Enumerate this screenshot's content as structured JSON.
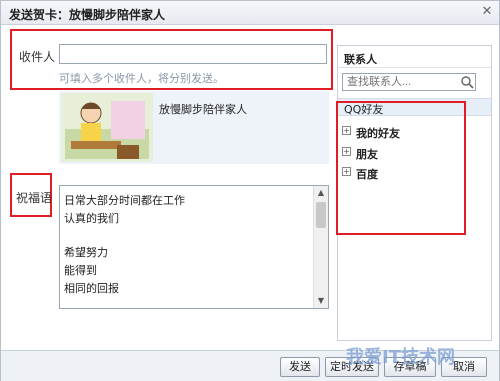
{
  "window": {
    "title": "发送贺卡：放慢脚步陪伴家人",
    "close_glyph": "✕"
  },
  "recipients": {
    "label": "收件人",
    "value": "",
    "hint": "可填入多个收件人，将分别发送。"
  },
  "card": {
    "name": "放慢脚步陪伴家人"
  },
  "blessing": {
    "label": "祝福语",
    "lines": [
      "日常大部分时间都在工作",
      "认真的我们",
      "",
      "希望努力",
      "能得到",
      "相同的回报"
    ]
  },
  "contacts": {
    "title": "联系人",
    "search_placeholder": "查找联系人...",
    "group": "QQ好友",
    "items": [
      {
        "label": "我的好友"
      },
      {
        "label": "朋友"
      },
      {
        "label": "百度"
      }
    ]
  },
  "buttons": {
    "send": "发送",
    "schedule": "定时发送",
    "draft": "存草稿",
    "cancel": "取消"
  },
  "watermark": "我爱IT技术网",
  "colors": {
    "highlight_border": "#e01c24",
    "accent": "#7a9fd6"
  }
}
